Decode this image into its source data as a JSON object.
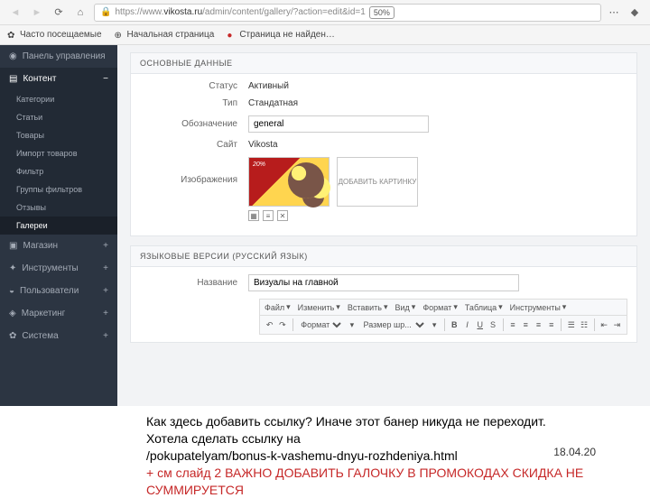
{
  "browser": {
    "url_prefix": "https://www.",
    "url_domain": "vikosta.ru",
    "url_path": "/admin/content/gallery/?action=edit&id=1",
    "zoom": "50%"
  },
  "bookmarks": {
    "frequent": "Часто посещаемые",
    "home": "Начальная страница",
    "notfound": "Страница не найден…"
  },
  "sidebar": {
    "dashboard": "Панель управления",
    "content": "Контент",
    "categories": "Категории",
    "articles": "Статьи",
    "goods": "Товары",
    "import": "Импорт товаров",
    "filter": "Фильтр",
    "filtergroups": "Группы фильтров",
    "reviews": "Отзывы",
    "galleries": "Галереи",
    "shop": "Магазин",
    "tools": "Инструменты",
    "users": "Пользователи",
    "marketing": "Маркетинг",
    "system": "Система"
  },
  "panel1": {
    "title": "ОСНОВНЫЕ ДАННЫЕ",
    "status_label": "Статус",
    "status_value": "Активный",
    "type_label": "Тип",
    "type_value": "Стандатная",
    "slug_label": "Обозначение",
    "slug_value": "general",
    "site_label": "Сайт",
    "site_value": "Vikosta",
    "images_label": "Изображения",
    "banner_discount": "20%",
    "add_image": "ДОБАВИТЬ КАРТИНКУ"
  },
  "panel2": {
    "title": "ЯЗЫКОВЫЕ ВЕРСИИ (РУССКИЙ ЯЗЫК)",
    "name_label": "Название",
    "name_value": "Визуалы на главной",
    "menu": {
      "file": "Файл",
      "edit": "Изменить",
      "insert": "Вставить",
      "view": "Вид",
      "format": "Формат",
      "table": "Таблица",
      "tools": "Инструменты"
    },
    "format_sel": "Формат",
    "size_sel": "Размер шр..."
  },
  "annotation": {
    "line1": "Как здесь добавить ссылку? Иначе этот банер никуда не переходит.",
    "line2": " Хотела сделать ссылку на",
    "line3": "/pokupatelyam/bonus-k-vashemu-dnyu-rozhdeniya.html",
    "line4a": "+ см слайд 2 ",
    "line4b": "ВАЖНО ДОБАВИТЬ ГАЛОЧКУ В ПРОМОКОДАХ СКИДКА НЕ СУММИРУЕТСЯ",
    "date": "18.04.20"
  }
}
